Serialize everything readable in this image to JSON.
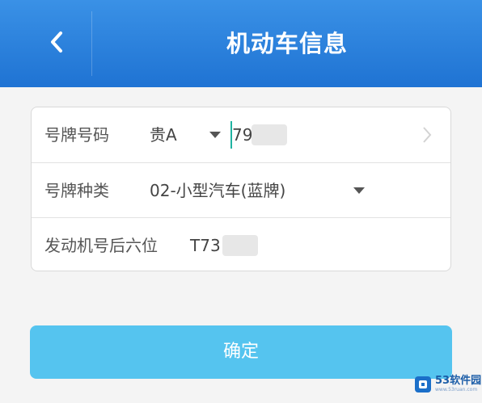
{
  "header": {
    "title": "机动车信息"
  },
  "form": {
    "plate_number": {
      "label": "号牌号码",
      "prefix": "贵A",
      "value": "79"
    },
    "plate_type": {
      "label": "号牌种类",
      "value": "02-小型汽车(蓝牌)"
    },
    "engine_number": {
      "label": "发动机号后六位",
      "value": "T73"
    }
  },
  "confirm_button": {
    "label": "确定"
  },
  "watermark": {
    "text": "53软件园",
    "url": "www.53ruan.com"
  },
  "colors": {
    "header_top": "#3a91e6",
    "header_bottom": "#1f73d3",
    "button": "#55c4ef",
    "cursor": "#20b3a2",
    "watermark_text": "#1b5da8"
  }
}
